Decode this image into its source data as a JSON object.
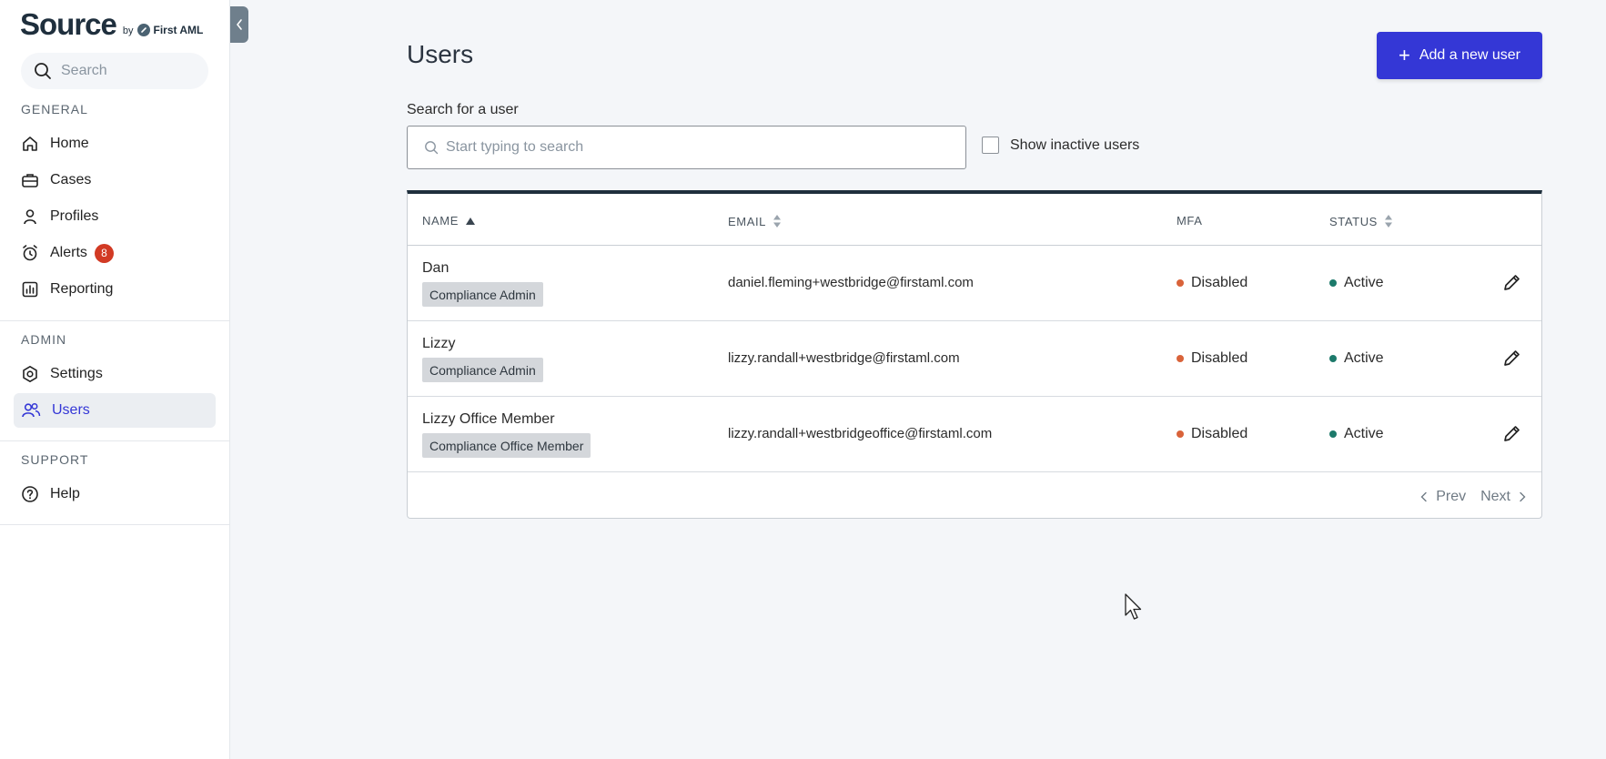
{
  "brand": {
    "name": "Source",
    "by": "by",
    "partner": "First AML"
  },
  "sidebar": {
    "search_placeholder": "Search",
    "general_label": "GENERAL",
    "general_items": [
      {
        "label": "Home",
        "icon": "home-icon"
      },
      {
        "label": "Cases",
        "icon": "briefcase-icon"
      },
      {
        "label": "Profiles",
        "icon": "user-icon"
      },
      {
        "label": "Alerts",
        "icon": "alarm-icon",
        "badge": "8"
      },
      {
        "label": "Reporting",
        "icon": "chart-icon"
      }
    ],
    "admin_label": "ADMIN",
    "admin_items": [
      {
        "label": "Settings",
        "icon": "gear-icon"
      },
      {
        "label": "Users",
        "icon": "users-icon",
        "active": true
      }
    ],
    "support_label": "SUPPORT",
    "support_items": [
      {
        "label": "Help",
        "icon": "help-icon"
      }
    ]
  },
  "main": {
    "title": "Users",
    "add_button": "Add a new user",
    "search_label": "Search for a user",
    "search_placeholder": "Start typing to search",
    "inactive_label": "Show inactive users",
    "columns": {
      "name": "NAME",
      "email": "EMAIL",
      "mfa": "MFA",
      "status": "STATUS"
    },
    "rows": [
      {
        "name": "Dan",
        "role": "Compliance Admin",
        "email": "daniel.fleming+westbridge@firstaml.com",
        "mfa": "Disabled",
        "status": "Active"
      },
      {
        "name": "Lizzy",
        "role": "Compliance Admin",
        "email": "lizzy.randall+westbridge@firstaml.com",
        "mfa": "Disabled",
        "status": "Active"
      },
      {
        "name": "Lizzy Office Member",
        "role": "Compliance Office Member",
        "email": "lizzy.randall+westbridgeoffice@firstaml.com",
        "mfa": "Disabled",
        "status": "Active"
      }
    ],
    "pager": {
      "prev": "Prev",
      "next": "Next"
    }
  },
  "colors": {
    "accent": "#3437d6",
    "mfa_disabled": "#d9633a",
    "status_active": "#1d7a6b",
    "badge": "#d23a24"
  }
}
